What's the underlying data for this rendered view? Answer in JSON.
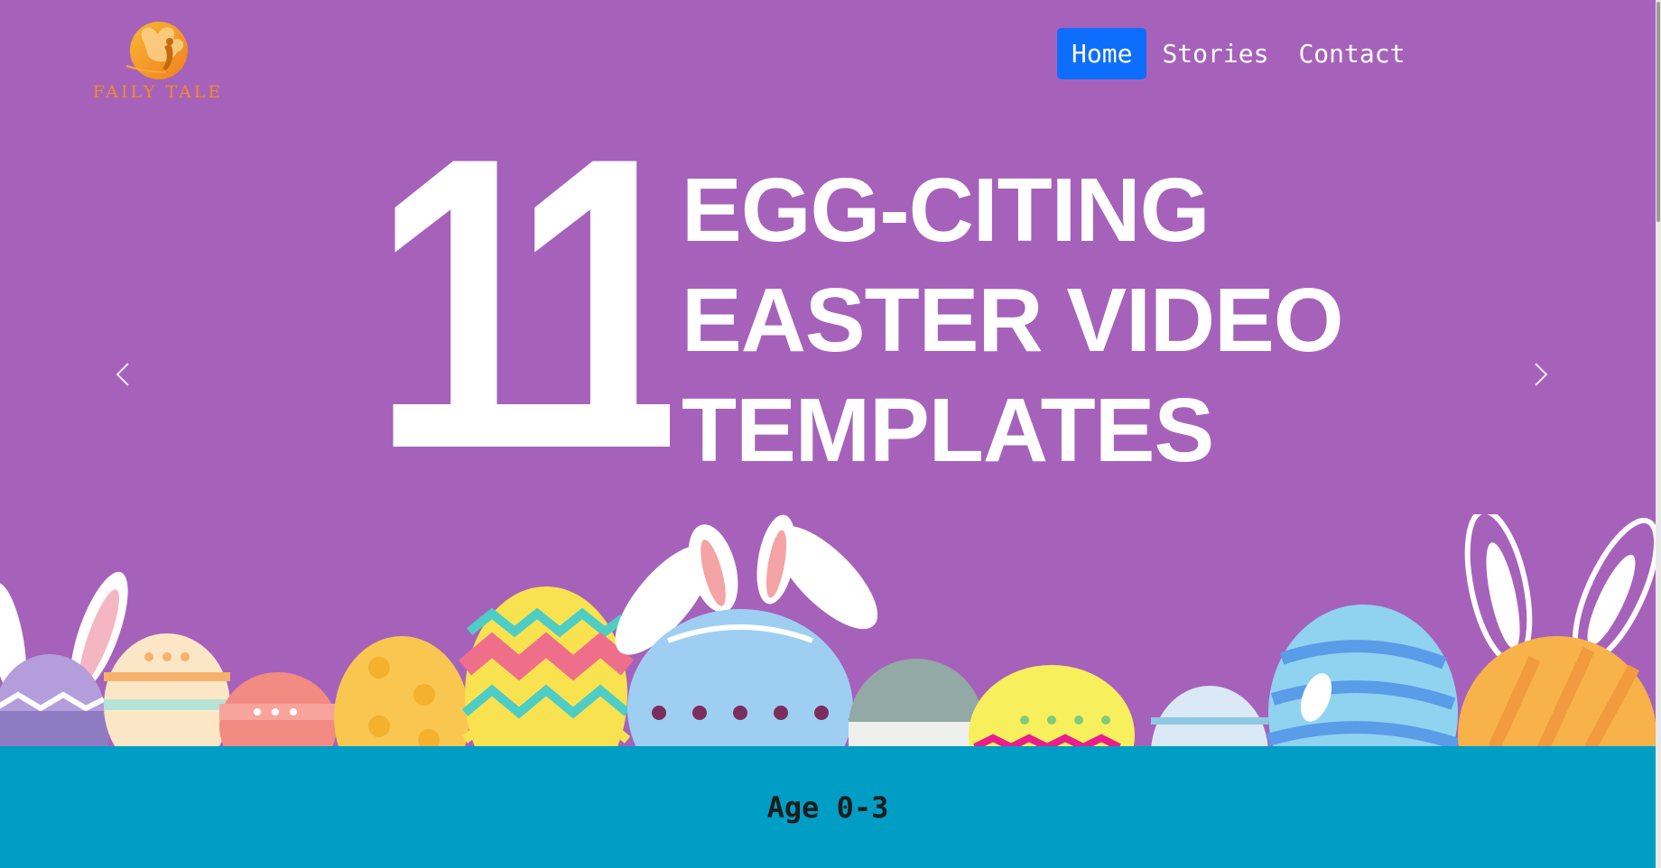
{
  "brand": {
    "logo_text": "FAILY TALE",
    "logo_icon": "fairy-icon",
    "logo_color": "#f08a2a"
  },
  "nav": {
    "items": [
      {
        "label": "Home",
        "active": true
      },
      {
        "label": "Stories",
        "active": false
      },
      {
        "label": "Contact",
        "active": false
      }
    ],
    "active_color": "#0d6efd"
  },
  "carousel": {
    "number": "11",
    "headline_lines": [
      "EGG-CITING",
      "EASTER VIDEO",
      "TEMPLATES"
    ],
    "background_color": "#a662ba",
    "prev_icon": "chevron-left-icon",
    "next_icon": "chevron-right-icon"
  },
  "age_section": {
    "title": "Age 0-3",
    "background_color": "#009dc4"
  }
}
